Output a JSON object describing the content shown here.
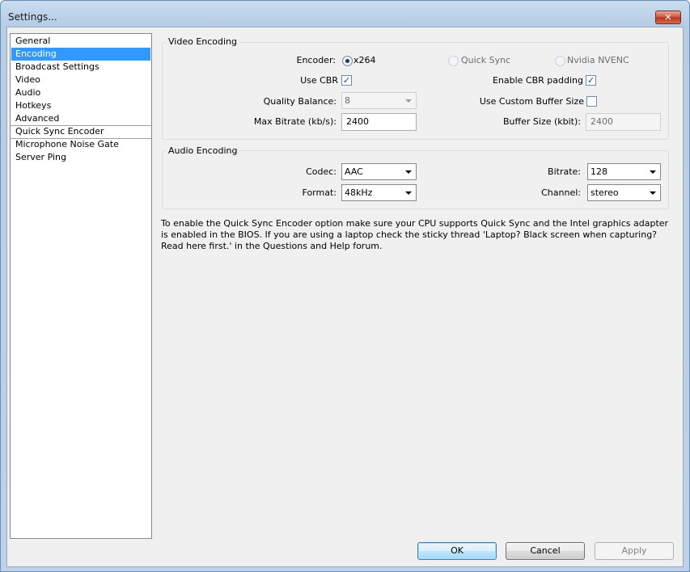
{
  "window": {
    "title": "Settings...",
    "close_symbol": "✕"
  },
  "sidebar": {
    "items": [
      "General",
      "Encoding",
      "Broadcast Settings",
      "Video",
      "Audio",
      "Hotkeys",
      "Advanced",
      "Quick Sync Encoder",
      "Microphone Noise Gate",
      "Server Ping"
    ],
    "selected": "Encoding"
  },
  "video_encoding": {
    "group_title": "Video Encoding",
    "encoder_label": "Encoder:",
    "encoder_options": [
      "x264",
      "Quick Sync",
      "Nvidia NVENC"
    ],
    "encoder_selected": "x264",
    "use_cbr_label": "Use CBR",
    "use_cbr_checked": true,
    "cbr_padding_label": "Enable CBR padding",
    "cbr_padding_checked": true,
    "quality_balance_label": "Quality Balance:",
    "quality_balance_value": "8",
    "custom_buffer_label": "Use Custom Buffer Size",
    "custom_buffer_checked": false,
    "max_bitrate_label": "Max Bitrate (kb/s):",
    "max_bitrate_value": "2400",
    "buffer_size_label": "Buffer Size (kbit):",
    "buffer_size_value": "2400"
  },
  "audio_encoding": {
    "group_title": "Audio Encoding",
    "codec_label": "Codec:",
    "codec_value": "AAC",
    "bitrate_label": "Bitrate:",
    "bitrate_value": "128",
    "format_label": "Format:",
    "format_value": "48kHz",
    "channel_label": "Channel:",
    "channel_value": "stereo"
  },
  "info_text": "To enable the Quick Sync Encoder option make sure your CPU supports Quick Sync and the Intel graphics adapter is enabled in the BIOS. If you are using a laptop check the sticky thread 'Laptop? Black screen when capturing? Read here first.' in the Questions and Help forum.",
  "buttons": {
    "ok": "OK",
    "cancel": "Cancel",
    "apply": "Apply"
  },
  "check_mark": "✓"
}
